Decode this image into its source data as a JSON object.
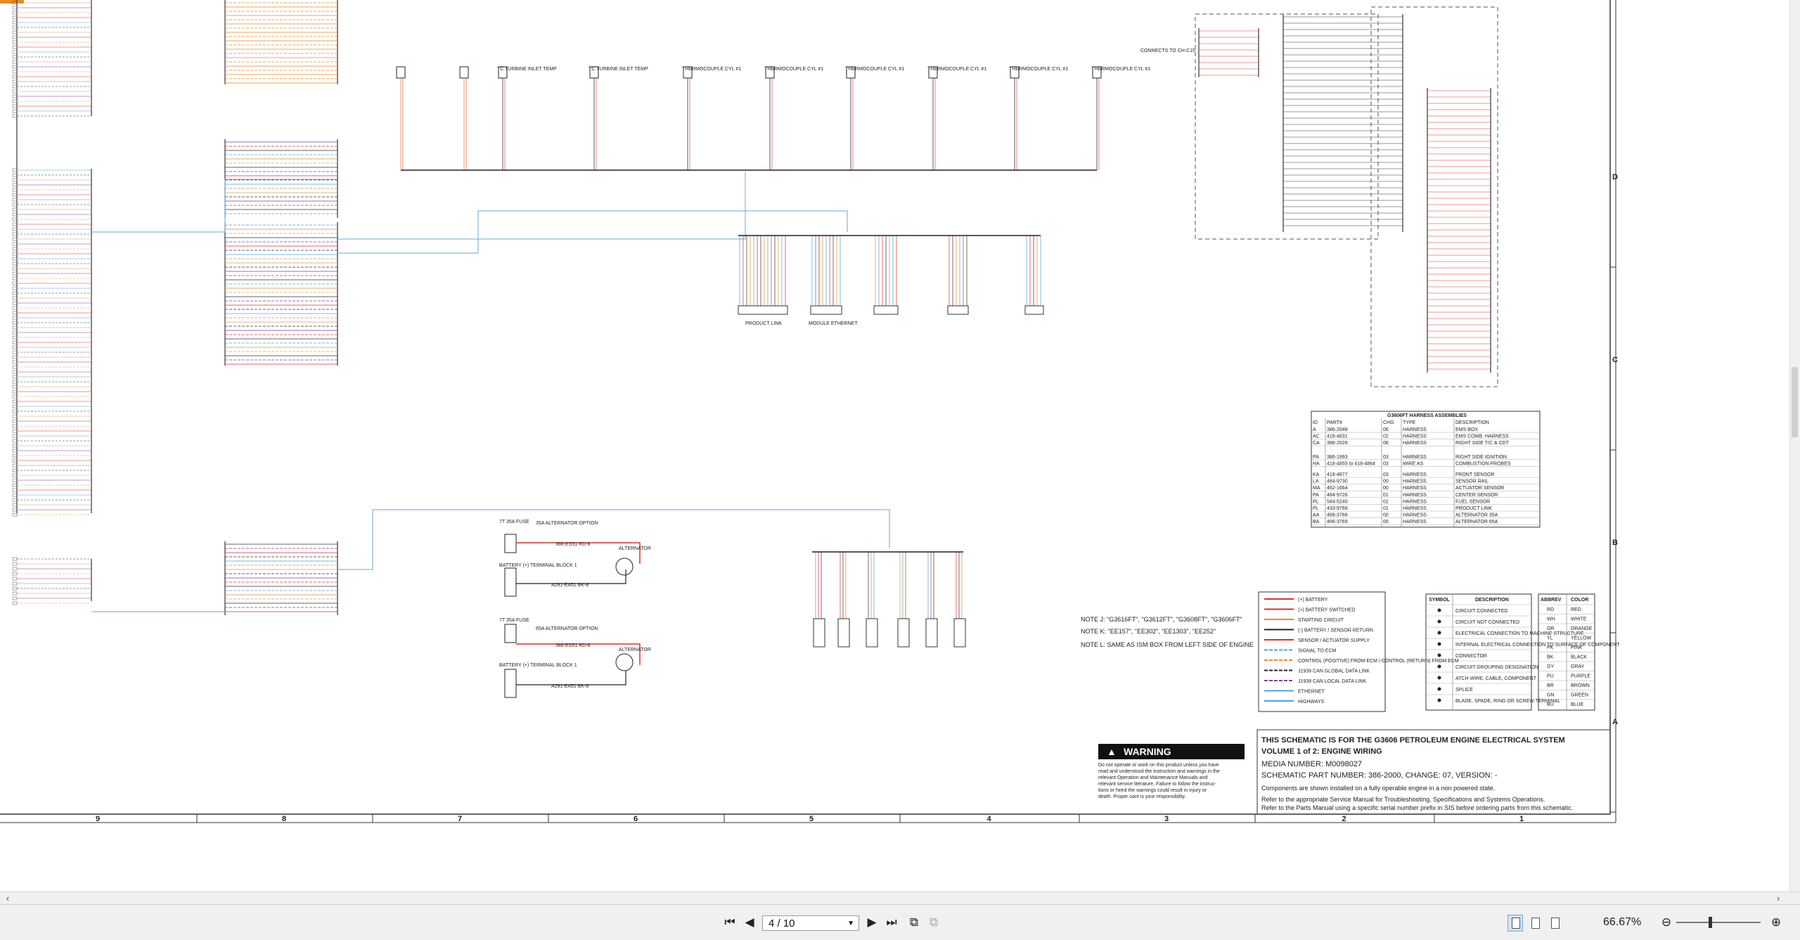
{
  "viewer": {
    "page_current": "4 / 10",
    "zoom": "66.67%",
    "hscroll_left_icon": "chevron-left-icon",
    "hscroll_right_icon": "chevron-right-icon"
  },
  "schematic": {
    "title_block": {
      "line1": "THIS SCHEMATIC IS FOR THE G3606 PETROLEUM ENGINE ELECTRICAL SYSTEM",
      "line2": "VOLUME 1 of 2: ENGINE WIRING",
      "line3": "MEDIA NUMBER: M0098027",
      "line4": "SCHEMATIC PART NUMBER: 386-2000, CHANGE: 07, VERSION: -",
      "line5": "Components are shown installed on a fully operable engine in a non powered state.",
      "line6": "Refer to the appropriate Service Manual for Troubleshooting, Specifications and Systems Operations.",
      "line7": "Refer to the Parts Manual using a specific serial number prefix in SIS before ordering parts from this schematic."
    },
    "warning": {
      "title": "WARNING",
      "text1": "Do not operate or work on this product unless you have",
      "text2": "read and understood the instruction and warnings in the",
      "text3": "relevant Operation and Maintenance Manuals and",
      "text4": "relevant service literature. Failure to follow the instruc-",
      "text5": "tions or heed the warnings could result in injury or",
      "text6": "death. Proper care is your responsibility."
    },
    "notes": {
      "note_j": "NOTE J: \"G3616FT\", \"G3612FT\", \"G3608FT\", \"G3606FT\"",
      "note_k": "NOTE K: \"EE157\", \"EE302\", \"EE1303\", \"EE252\"",
      "note_l": "NOTE L: SAME AS ISM BOX FROM LEFT SIDE OF ENGINE"
    },
    "zone_columns": [
      "9",
      "8",
      "7",
      "6",
      "5",
      "4",
      "3",
      "2",
      "1"
    ],
    "zone_rows": [
      "D",
      "C",
      "B",
      "A"
    ],
    "harness_table": {
      "title": "G3606FT HARNESS ASSEMBLIES",
      "headers": [
        "ID",
        "PART#",
        "CHG",
        "TYPE",
        "DESCRIPTION"
      ],
      "rows": [
        [
          "A",
          "386-2048",
          "06",
          "HARNESS",
          "EMS BOX"
        ],
        [
          "AC",
          "418-4831",
          "02",
          "HARNESS",
          "EMS COMB. HARNESS"
        ],
        [
          "CA",
          "386-2026",
          "06",
          "HARNESS",
          "RIGHT SIDE T/C & CDT"
        ],
        [
          "PA",
          "386-1993",
          "03",
          "HARNESS",
          "RIGHT SIDE IGNITION"
        ],
        [
          "HA",
          "418-4855 to 418-4864",
          "03",
          "WIRE AS",
          "COMBUSTION PROBES"
        ],
        [
          "KA",
          "418-4877",
          "03",
          "HARNESS",
          "FRONT SENSOR"
        ],
        [
          "LA",
          "464-9730",
          "00",
          "HARNESS",
          "SENSOR RAIL"
        ],
        [
          "MA",
          "462-1664",
          "00",
          "HARNESS",
          "ACTUATOR SENSOR"
        ],
        [
          "PA",
          "464-9726",
          "01",
          "HARNESS",
          "CENTER SENSOR"
        ],
        [
          "PL",
          "544-5240",
          "01",
          "HARNESS",
          "FUEL SENSOR"
        ],
        [
          "PL",
          "433-9768",
          "01",
          "HARNESS",
          "PRODUCT LINK"
        ],
        [
          "AA",
          "466-3766",
          "00",
          "HARNESS",
          "ALTERNATOR 35A"
        ],
        [
          "BA",
          "466-3769",
          "00",
          "HARNESS",
          "ALTERNATOR 65A"
        ]
      ]
    },
    "line_legend": [
      "(+) BATTERY",
      "(+) BATTERY SWITCHED",
      "STARTING CIRCUIT",
      "(-) BATTERY / SENSOR RETURN",
      "SENSOR / ACTUATOR SUPPLY",
      "SIGNAL TO ECM",
      "CONTROL (POSITIVE) FROM ECM / CONTROL (RETURN) FROM ECM",
      "J1939 CAN GLOBAL DATA LINK",
      "J1939 CAN LOCAL DATA LINK",
      "ETHERNET",
      "HIGHWAYS"
    ],
    "line_legend_colors": [
      "#d9322b",
      "#d9322b",
      "#e8892a",
      "#222222",
      "#d9322b",
      "#4aa3df",
      "#e8892a",
      "#222222",
      "#7b3fa0",
      "#4aa3df",
      "#4aa3df"
    ],
    "symbol_table": {
      "headers": [
        "SYMBOL",
        "DESCRIPTION"
      ],
      "rows": [
        "CIRCUIT CONNECTED",
        "CIRCUIT NOT CONNECTED",
        "ELECTRICAL CONNECTION TO MACHINE STRUCTURE",
        "INTERNAL ELECTRICAL CONNECTION TO SURFACE OF COMPONENT",
        "CONNECTOR",
        "CIRCUIT GROUPING DESIGNATION",
        "ATCH WIRE, CABLE, COMPONENT",
        "SPLICE",
        "BLADE, SPADE, RING OR SCREW TERMINAL"
      ]
    },
    "color_table": {
      "headers": [
        "ABBREV",
        "COLOR"
      ],
      "rows": [
        [
          "RD",
          "RED"
        ],
        [
          "WH",
          "WHITE"
        ],
        [
          "OR",
          "ORANGE"
        ],
        [
          "YL",
          "YELLOW"
        ],
        [
          "PK",
          "PINK"
        ],
        [
          "BK",
          "BLACK"
        ],
        [
          "GY",
          "GRAY"
        ],
        [
          "PU",
          "PURPLE"
        ],
        [
          "BR",
          "BROWN"
        ],
        [
          "GN",
          "GREEN"
        ],
        [
          "BU",
          "BLUE"
        ]
      ]
    },
    "diagram_labels": {
      "connects_to": "CONNECTS TO CH-C15",
      "product_link": "PRODUCT LINK",
      "module_ethernet": "MODULE ETHERNET",
      "thermocouple": "THERMOCOUPLE CYL #1",
      "turbine_inlet": "TC TURBINE INLET TEMP",
      "alt_35a": "35A ALTERNATOR OPTION",
      "alt_65a": "65A ALTERNATOR OPTION",
      "alt_label": "ALTERNATOR",
      "battery_label": "BATTERY (+) TERMINAL BLOCK 1",
      "fuse_label": "7T 35A FUSE",
      "wire_386": "386-ES51 RD-8",
      "wire_a291": "A291-EA51 BK-8"
    }
  }
}
